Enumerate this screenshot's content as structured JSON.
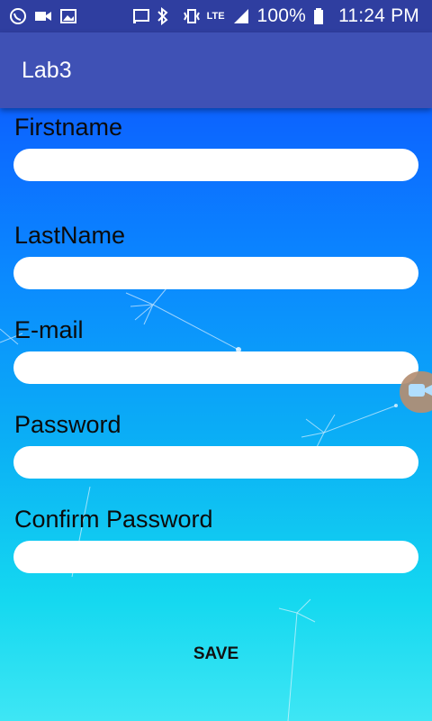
{
  "status_bar": {
    "battery": "100%",
    "time": "11:24 PM",
    "network_label": "LTE",
    "icons": [
      "viber-icon",
      "video-icon",
      "image-icon",
      "cast-icon",
      "bluetooth-icon",
      "vibrate-icon",
      "signal-icon",
      "battery-icon"
    ]
  },
  "app_bar": {
    "title": "Lab3"
  },
  "form": {
    "fields": [
      {
        "label": "Firstname",
        "value": ""
      },
      {
        "label": "LastName",
        "value": ""
      },
      {
        "label": "E-mail",
        "value": ""
      },
      {
        "label": "Password",
        "value": ""
      },
      {
        "label": "Confirm Password",
        "value": ""
      }
    ],
    "save_label": "SAVE"
  },
  "floating_button": {
    "icon": "video-camera-icon"
  }
}
